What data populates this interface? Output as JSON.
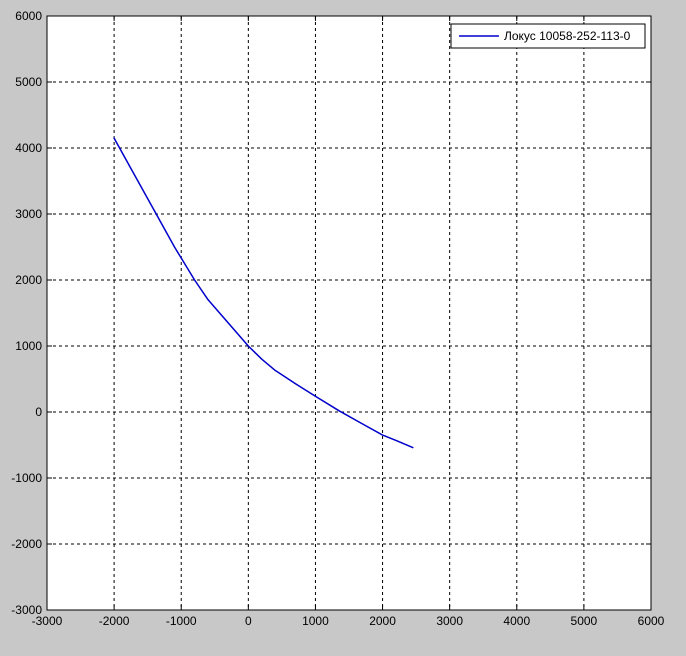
{
  "chart_data": {
    "type": "line",
    "title": "",
    "xlabel": "",
    "ylabel": "",
    "xlim": [
      -3000,
      6000
    ],
    "ylim": [
      -3000,
      6000
    ],
    "xticks": [
      -3000,
      -2000,
      -1000,
      0,
      1000,
      2000,
      3000,
      4000,
      5000,
      6000
    ],
    "yticks": [
      -3000,
      -2000,
      -1000,
      0,
      1000,
      2000,
      3000,
      4000,
      5000,
      6000
    ],
    "xtick_labels": [
      "-3000",
      "-2000",
      "-1000",
      "0",
      "1000",
      "2000",
      "3000",
      "4000",
      "5000",
      "6000"
    ],
    "ytick_labels": [
      "-3000",
      "-2000",
      "-1000",
      "0",
      "1000",
      "2000",
      "3000",
      "4000",
      "5000",
      "6000"
    ],
    "grid": true,
    "legend_position": "top-right",
    "series": [
      {
        "name": "Локус 10058-252-113-0",
        "color": "#0000cc",
        "points": [
          [
            -2000,
            4150
          ],
          [
            -1700,
            3600
          ],
          [
            -1400,
            3050
          ],
          [
            -1100,
            2500
          ],
          [
            -800,
            2000
          ],
          [
            -600,
            1700
          ],
          [
            -300,
            1350
          ],
          [
            0,
            1000
          ],
          [
            200,
            800
          ],
          [
            400,
            630
          ],
          [
            700,
            430
          ],
          [
            1000,
            240
          ],
          [
            1350,
            20
          ],
          [
            1700,
            -180
          ],
          [
            2000,
            -350
          ],
          [
            2200,
            -430
          ],
          [
            2450,
            -540
          ]
        ]
      }
    ]
  }
}
